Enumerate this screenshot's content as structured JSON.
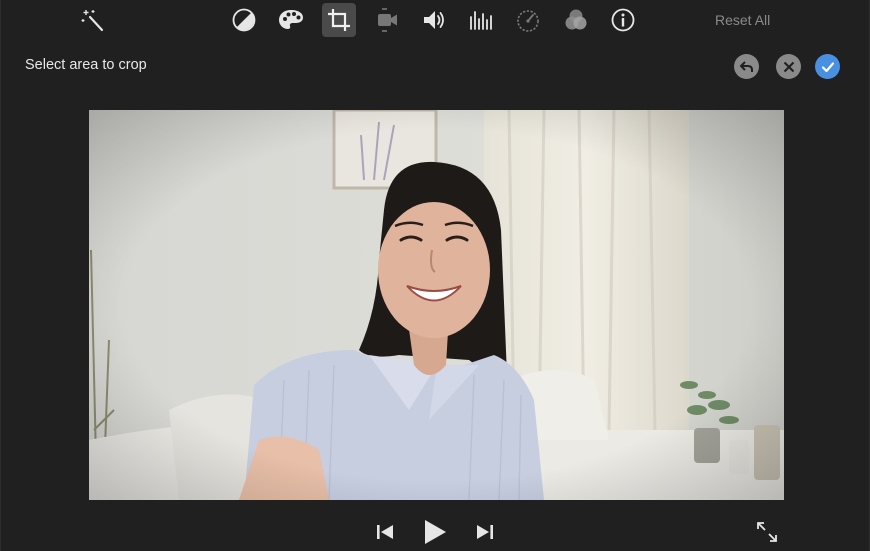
{
  "toolbar": {
    "tools": [
      {
        "name": "magic-wand-icon"
      },
      {
        "name": "color-balance-icon"
      },
      {
        "name": "color-palette-icon"
      },
      {
        "name": "crop-icon",
        "active": true
      },
      {
        "name": "video-camera-stabilize-icon"
      },
      {
        "name": "volume-icon"
      },
      {
        "name": "equalizer-icon"
      },
      {
        "name": "speedometer-icon"
      },
      {
        "name": "filters-icon"
      },
      {
        "name": "info-icon"
      }
    ],
    "reset_all_label": "Reset All"
  },
  "crop_bar": {
    "status_text": "Select area to crop",
    "undo_icon": "undo-arrow-icon",
    "cancel_icon": "cancel-x-icon",
    "confirm_icon": "checkmark-icon",
    "confirm_color": "#4a90e2"
  },
  "viewer": {
    "content": "selfie video frame"
  },
  "playback": {
    "prev_icon": "skip-back-icon",
    "play_icon": "play-icon",
    "next_icon": "skip-forward-icon",
    "fullscreen_icon": "fullscreen-expand-icon"
  }
}
